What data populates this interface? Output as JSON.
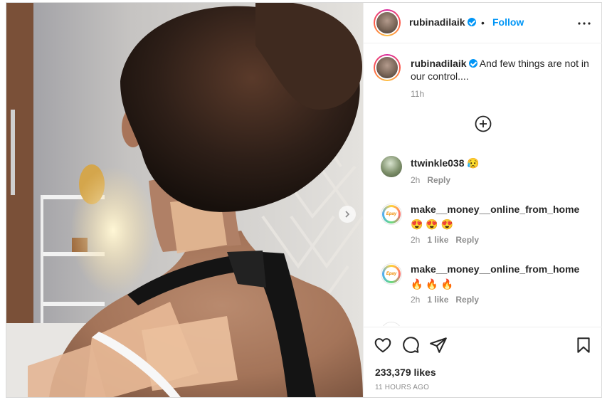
{
  "post": {
    "username": "rubinadilaik",
    "follow_label": "Follow",
    "separator": "•",
    "caption_username": "rubinadilaik",
    "caption_text": "And few things are not in our control....",
    "caption_time": "11h",
    "likes": "233,379 likes",
    "time_ago": "11 HOURS AGO"
  },
  "comments": [
    {
      "username": "ttwinkle038",
      "text": "😥",
      "time": "2h",
      "likes": "",
      "reply_label": "Reply"
    },
    {
      "username": "make__money__online_from_home",
      "text": "😍 😍 😍",
      "time": "2h",
      "likes": "1 like",
      "reply_label": "Reply"
    },
    {
      "username": "make__money__online_from_home",
      "text": "🔥 🔥 🔥",
      "time": "2h",
      "likes": "1 like",
      "reply_label": "Reply"
    }
  ],
  "avatar_badge_text": "Epay",
  "icons": {
    "more": "more-options-icon",
    "load_more": "plus-circle-icon",
    "like": "heart-icon",
    "comment": "comment-icon",
    "share": "paper-plane-icon",
    "save": "bookmark-icon",
    "verified": "verified-badge-icon",
    "next": "chevron-right-icon"
  },
  "colors": {
    "accent": "#0095f6",
    "text": "#262626",
    "muted": "#8e8e8e",
    "border": "#dbdbdb"
  }
}
